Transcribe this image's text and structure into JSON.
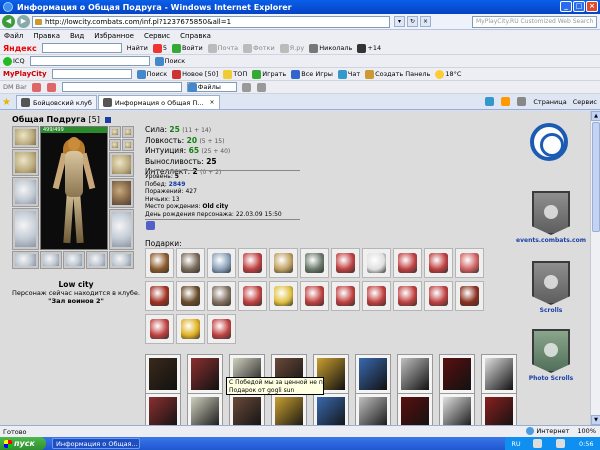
{
  "window": {
    "title": "Информация о Общая Подруга - Windows Internet Explorer"
  },
  "address": {
    "url": "http://lowcity.combats.com/inf.pl?1237675850&all=1",
    "search_placeholder": "MyPlayCity.RU Customized Web Search"
  },
  "menu": [
    "Файл",
    "Правка",
    "Вид",
    "Избранное",
    "Сервис",
    "Справка"
  ],
  "toolbar1": {
    "brand": "Яндекс",
    "find": "Найти",
    "count": "5",
    "login": "Войти",
    "mail": "Почта",
    "photos": "Фотки",
    "ya_ru": "Я.ру",
    "user": "Николаль",
    "plus": "+14"
  },
  "toolbar2": {
    "icq": "ICQ",
    "search": "Поиск"
  },
  "toolbar3": {
    "brand": "MyPlayCity",
    "search": "Поиск",
    "new": "Новое [50]",
    "top": "ТОП",
    "play": "Играть",
    "all_games": "Все Игры",
    "chat": "Чат",
    "create_panel": "Создать Панель",
    "weather": "18°C"
  },
  "toolbar4": {
    "dm": "DM Bar",
    "files": "Файлы"
  },
  "tabs": [
    {
      "label": "Бойцовский клуб"
    },
    {
      "label": "Информация о Общая П..."
    }
  ],
  "tab_tools": {
    "page": "Страница",
    "service": "Сервис"
  },
  "character": {
    "name": "Общая Подруга",
    "level": "[5]",
    "hp": "499/499",
    "city": "Low city",
    "location_text": "Персонаж сейчас находится в клубе.",
    "room": "\"Зал воинов 2\""
  },
  "stats": [
    {
      "label": "Сила:",
      "value": "25",
      "extra": "(11 + 14)"
    },
    {
      "label": "Ловкость:",
      "value": "20",
      "extra": "(5 + 15)"
    },
    {
      "label": "Интуиция:",
      "value": "65",
      "extra": "(25 + 40)"
    },
    {
      "label": "Выносливость:",
      "value": "25",
      "extra": ""
    },
    {
      "label": "Интеллект:",
      "value": "2",
      "extra": "(0 + 2)"
    }
  ],
  "info": [
    {
      "label": "Уровень:",
      "value": "5"
    },
    {
      "label": "Побед:",
      "value": "2849"
    },
    {
      "label": "Поражений:",
      "value": "427"
    },
    {
      "label": "Ничьих:",
      "value": "13"
    },
    {
      "label": "Место рождения:",
      "value": "Old city"
    },
    {
      "label": "День рождения персонажа:",
      "value": "22.03.09 15:50"
    }
  ],
  "gifts_label": "Подарки:",
  "tooltip": {
    "line1": "С Победой мы за ценной не постоим",
    "line2": "Подарок от gogli sun"
  },
  "sidebar": {
    "events_label": "events.combats.com",
    "scrolls_label": "Scrolls",
    "photo_scrolls_label": "Photo Scrolls"
  },
  "status": {
    "ready": "Готово",
    "zone": "Интернет",
    "zoom": "100%"
  },
  "taskbar": {
    "start": "пуск",
    "item": "Информация о Общая...",
    "lang": "RU",
    "time": "0:56"
  },
  "colors": {
    "accent": "#0a5fe8",
    "stat_green": "#137f13",
    "link_blue": "#123aa8"
  }
}
